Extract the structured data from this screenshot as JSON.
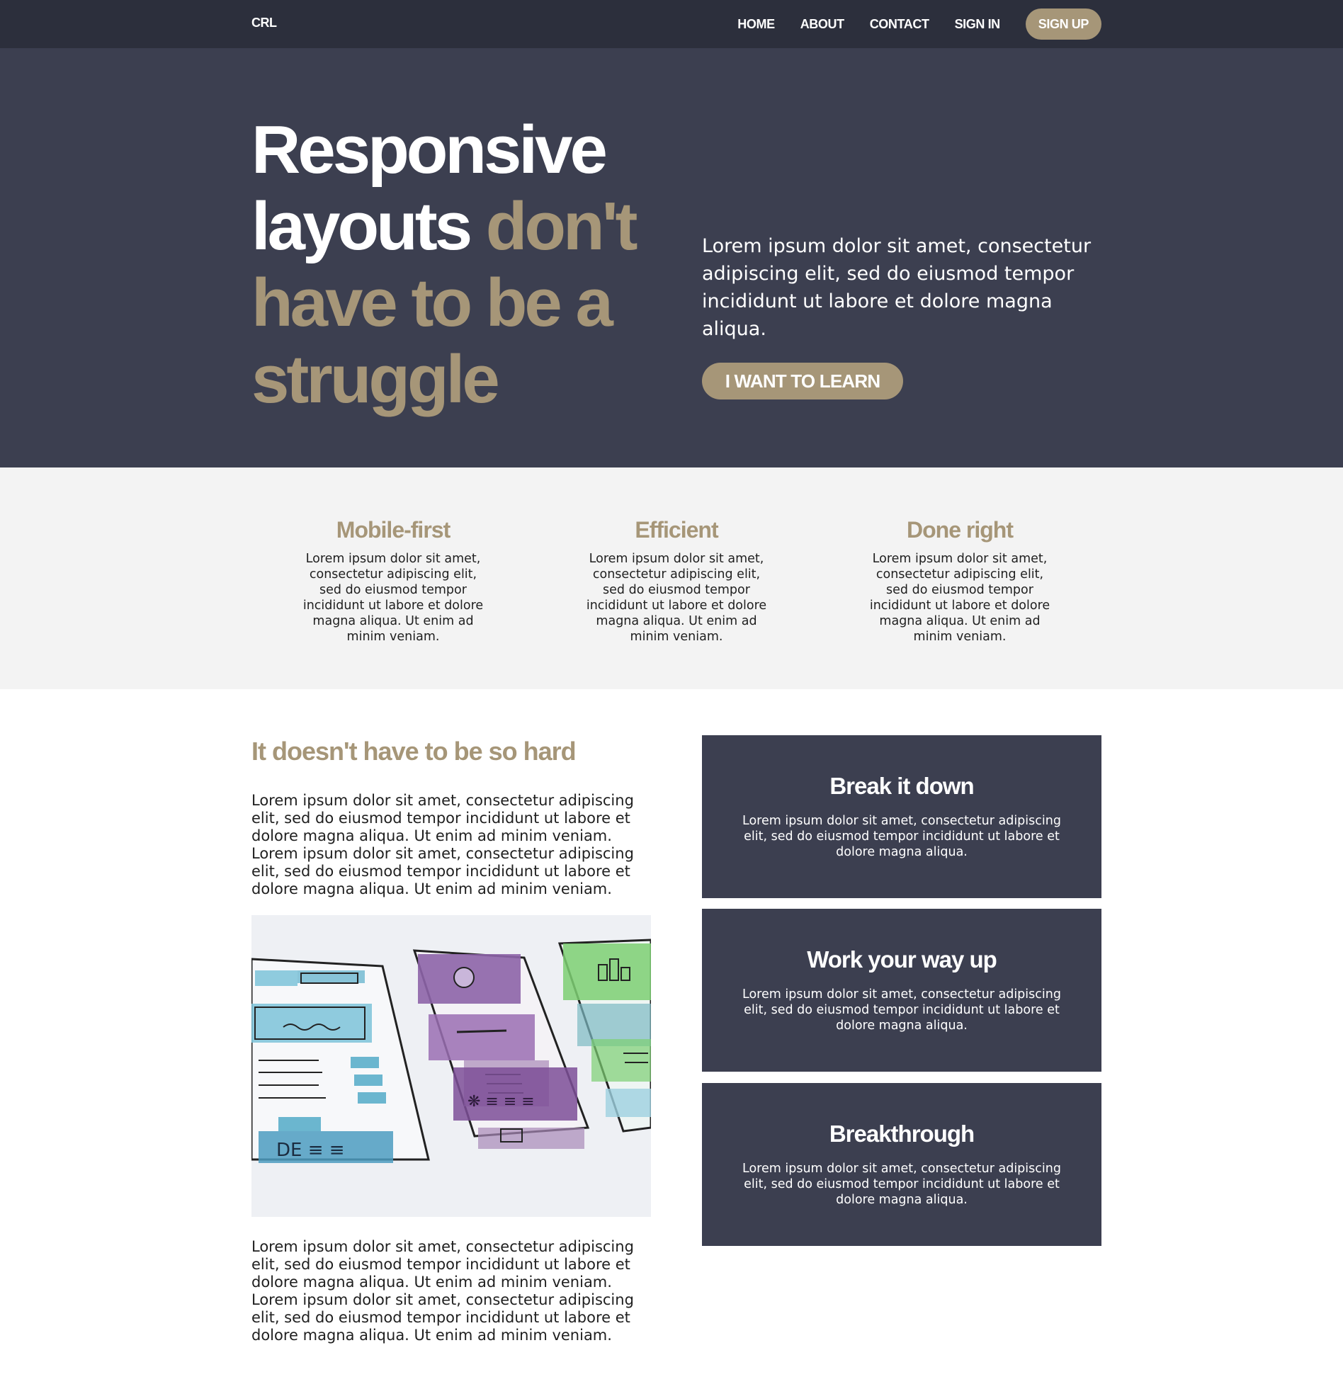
{
  "nav": {
    "logo": "CRL",
    "links": [
      "HOME",
      "ABOUT",
      "CONTACT",
      "SIGN IN"
    ],
    "signup_label": "SIGN UP"
  },
  "hero": {
    "title_white": "Responsive layouts",
    "title_accent": "don't have to be a struggle",
    "text": "Lorem ipsum dolor sit amet, consectetur adipiscing elit, sed do eiusmod tempor incididunt ut labore et dolore magna aliqua.",
    "button_label": "I WANT TO LEARN"
  },
  "features": [
    {
      "title": "Mobile-first",
      "text": "Lorem ipsum dolor sit amet, consectetur adipiscing elit, sed do eiusmod tempor incididunt ut labore et dolore magna aliqua. Ut enim ad minim veniam."
    },
    {
      "title": "Efficient",
      "text": "Lorem ipsum dolor sit amet, consectetur adipiscing elit, sed do eiusmod tempor incididunt ut labore et dolore magna aliqua. Ut enim ad minim veniam."
    },
    {
      "title": "Done right",
      "text": "Lorem ipsum dolor sit amet, consectetur adipiscing elit, sed do eiusmod tempor incididunt ut labore et dolore magna aliqua. Ut enim ad minim veniam."
    }
  ],
  "content": {
    "title": "It doesn't have to be so hard",
    "para1": "Lorem ipsum dolor sit amet, consectetur adipiscing elit, sed do eiusmod tempor incididunt ut labore et dolore magna aliqua. Ut enim ad minim veniam. Lorem ipsum dolor sit amet, consectetur adipiscing elit, sed do eiusmod tempor incididunt ut labore et dolore magna aliqua. Ut enim ad minim veniam.",
    "para2": "Lorem ipsum dolor sit amet, consectetur adipiscing elit, sed do eiusmod tempor incididunt ut labore et dolore magna aliqua. Ut enim ad minim veniam. Lorem ipsum dolor sit amet, consectetur adipiscing elit, sed do eiusmod tempor incididunt ut labore et dolore magna aliqua. Ut enim ad minim veniam."
  },
  "cards": [
    {
      "title": "Break it down",
      "text": "Lorem ipsum dolor sit amet, consectetur adipiscing elit, sed do eiusmod tempor incididunt ut labore et dolore magna aliqua."
    },
    {
      "title": "Work your way up",
      "text": "Lorem ipsum dolor sit amet, consectetur adipiscing elit, sed do eiusmod tempor incididunt ut labore et dolore magna aliqua."
    },
    {
      "title": "Breakthrough",
      "text": "Lorem ipsum dolor sit amet, consectetur adipiscing elit, sed do eiusmod tempor incididunt ut labore et dolore magna aliqua."
    }
  ],
  "colors": {
    "nav_bg": "#2c2f3c",
    "hero_bg": "#3c3f50",
    "accent": "#a69678",
    "features_bg": "#f3f3f3"
  }
}
